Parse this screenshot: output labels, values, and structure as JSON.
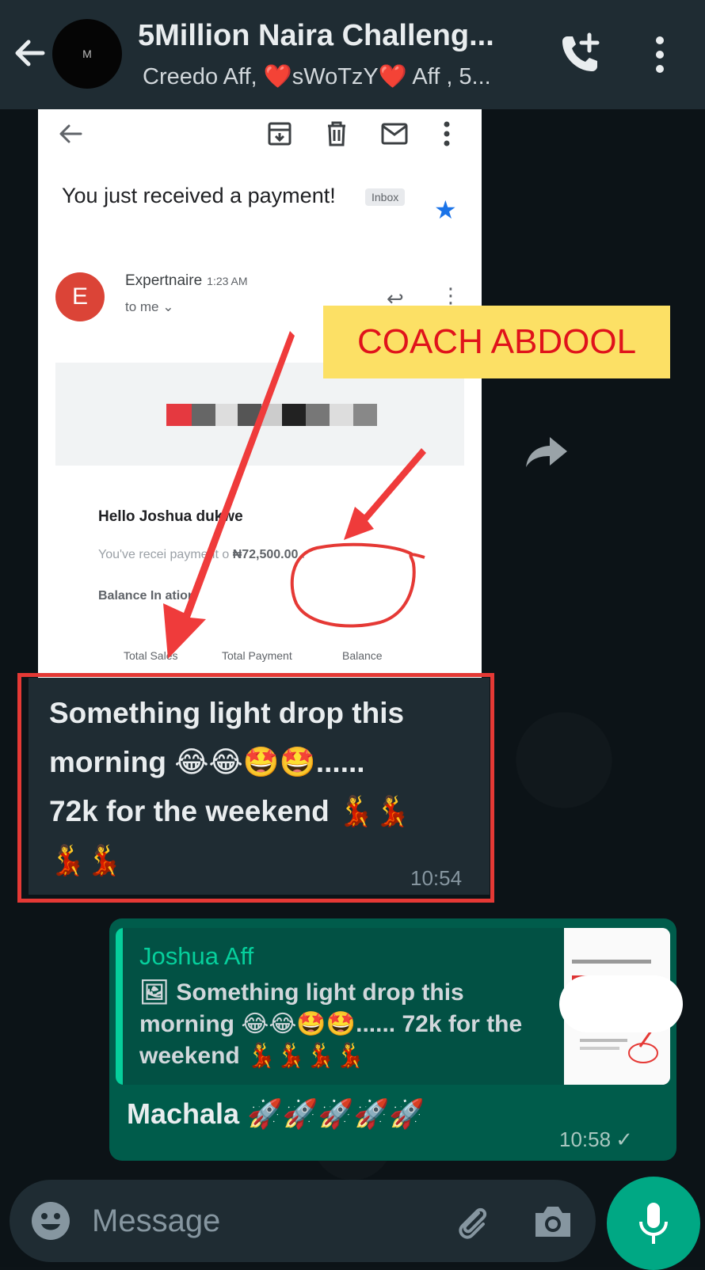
{
  "header": {
    "title": "5Million Naira Challeng...",
    "subtitle": "Creedo Aff, ❤️sWoTzY❤️ Aff , 5...",
    "avatar_letter": "M"
  },
  "screenshot": {
    "subject": "You just received a payment!",
    "inbox_badge": "Inbox",
    "sender_initial": "E",
    "sender_name": "Expertnaire",
    "sender_time": "1:23 AM",
    "to_line": "to me ⌄",
    "hello": "Hello Joshua   dukwe",
    "received_prefix": "You've recei     payment o",
    "amount": "₦72,500.00",
    "amount_suffix": " .",
    "balance": "Balance In        ation",
    "columns": [
      "Total Sales",
      "Total Payment",
      "Balance"
    ]
  },
  "annotation": {
    "label": "COACH ABDOOL",
    "label_bg": "#fce065",
    "label_color": "#e0131b",
    "arrow_color": "#ef3b3b"
  },
  "messages": {
    "incoming": {
      "text_line1": "Something light drop this",
      "text_line2": "morning 😂😂🤩🤩......",
      "text_line3": "72k for the weekend 💃💃",
      "text_line4": "💃💃",
      "time": "10:54"
    },
    "outgoing": {
      "quote_author": "Joshua Aff",
      "quote_text": "🖼 Something light drop this morning 😂😂🤩🤩...... 72k for the weekend 💃💃💃💃",
      "text": "Machala 🚀🚀🚀🚀🚀",
      "time": "10:58",
      "status": "✓"
    }
  },
  "input": {
    "placeholder": "Message"
  },
  "colors": {
    "header": "#1f2c33",
    "outgoing": "#005c4b",
    "incoming": "#1f2c33",
    "accent": "#00a884"
  }
}
